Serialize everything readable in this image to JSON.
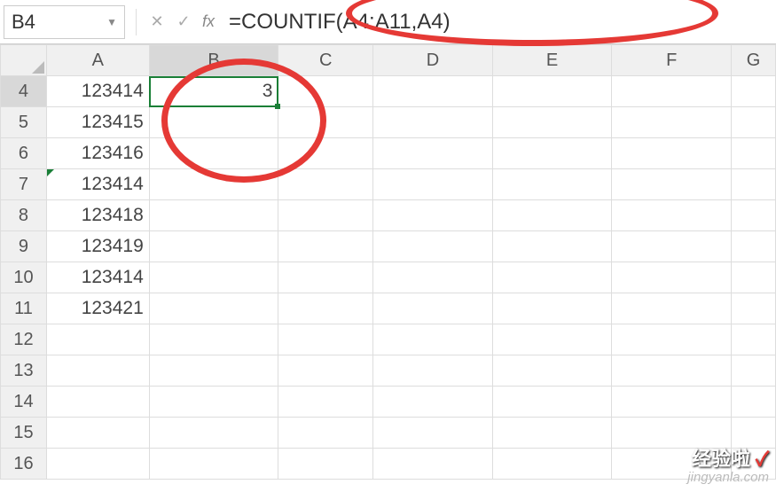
{
  "name_box": {
    "value": "B4"
  },
  "formula_bar": {
    "fx_label": "fx",
    "formula": "=COUNTIF(A4:A11,A4)"
  },
  "columns": [
    "A",
    "B",
    "C",
    "D",
    "E",
    "F",
    "G"
  ],
  "rows": [
    "4",
    "5",
    "6",
    "7",
    "8",
    "9",
    "10",
    "11",
    "12",
    "13",
    "14",
    "15",
    "16"
  ],
  "active_col": "B",
  "active_row": "4",
  "cells": {
    "A4": "123414",
    "A5": "123415",
    "A6": "123416",
    "A7": "123414",
    "A8": "123418",
    "A9": "123419",
    "A10": "123414",
    "A11": "123421",
    "B4": "3"
  },
  "watermark": {
    "line1": "经验啦",
    "line2": "jingyanla.com",
    "check": "✓"
  },
  "chart_data": {
    "type": "table",
    "title": "",
    "columns": [
      "A",
      "B"
    ],
    "rows": [
      {
        "A": 123414,
        "B": 3
      },
      {
        "A": 123415,
        "B": null
      },
      {
        "A": 123416,
        "B": null
      },
      {
        "A": 123414,
        "B": null
      },
      {
        "A": 123418,
        "B": null
      },
      {
        "A": 123419,
        "B": null
      },
      {
        "A": 123414,
        "B": null
      },
      {
        "A": 123421,
        "B": null
      }
    ]
  }
}
